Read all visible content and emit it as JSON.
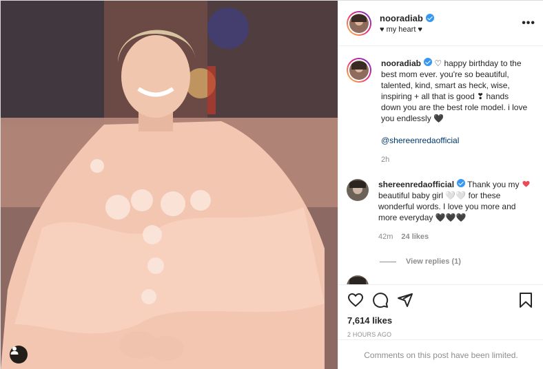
{
  "post": {
    "author": {
      "username": "nooradiab",
      "subtitle": "♥ my heart ♥",
      "verified": true,
      "avatar": "avatar-woman"
    },
    "more_icon": "more-horizontal-icon",
    "caption": {
      "username": "nooradiab",
      "text": "♡ happy birthday to the best mom ever. you're so beautiful, talented, kind, smart as heck, wise, inspiring + all that is good ❣ hands down you are the best role model. i love you endlessly 🖤",
      "mention": "@shereenredaofficial",
      "time": "2h"
    },
    "comments": [
      {
        "username": "shereenredaofficial",
        "verified": true,
        "text": "Thank you my beautiful baby girl 🤍🤍 for these wonderful words. I love you more and more everyday 🖤🖤🖤",
        "time": "42m",
        "likes": "24 likes",
        "liked": true,
        "view_replies": "View replies (1)"
      }
    ],
    "actions": {
      "like_icon": "heart-outline-icon",
      "comment_icon": "comment-icon",
      "share_icon": "share-icon",
      "save_icon": "bookmark-icon"
    },
    "likes_count": "7,614 likes",
    "timestamp": "2 HOURS AGO",
    "comments_limited": "Comments on this post have been limited.",
    "colors": {
      "verified_blue": "#3897f0",
      "like_red": "#ed4956",
      "mention_blue": "#00376b",
      "meta_gray": "#8e8e8e"
    },
    "photo": {
      "user_tags_icon": "user-tag-icon"
    }
  }
}
